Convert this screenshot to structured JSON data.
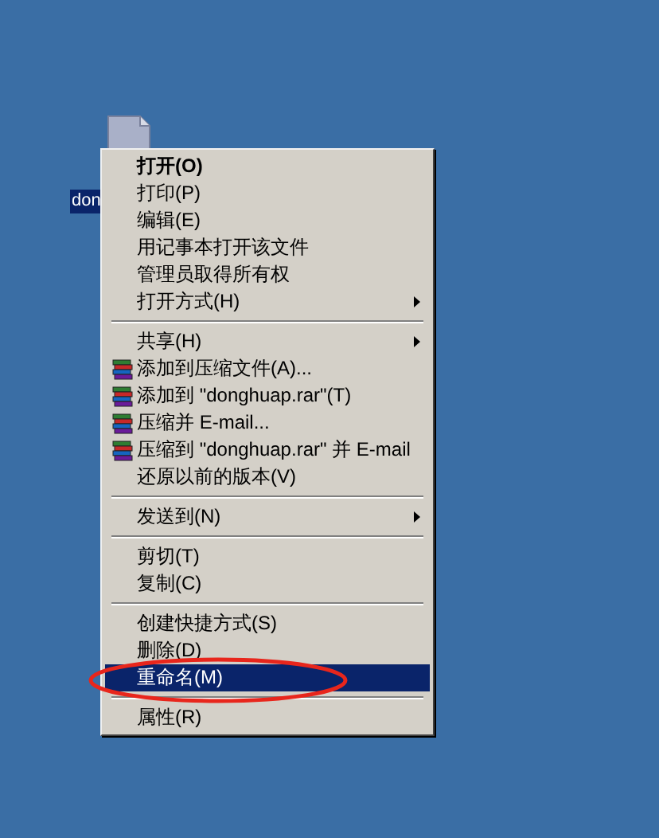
{
  "desktop_icon": {
    "label": "don",
    "selected": true
  },
  "context_menu": {
    "groups": [
      {
        "items": [
          {
            "label": "打开(O)",
            "kind": "plain",
            "default": true,
            "submenu": false,
            "selected": false
          },
          {
            "label": "打印(P)",
            "kind": "plain",
            "default": false,
            "submenu": false,
            "selected": false
          },
          {
            "label": "编辑(E)",
            "kind": "plain",
            "default": false,
            "submenu": false,
            "selected": false
          },
          {
            "label": "用记事本打开该文件",
            "kind": "plain",
            "default": false,
            "submenu": false,
            "selected": false
          },
          {
            "label": "管理员取得所有权",
            "kind": "plain",
            "default": false,
            "submenu": false,
            "selected": false
          },
          {
            "label": "打开方式(H)",
            "kind": "plain",
            "default": false,
            "submenu": true,
            "selected": false
          }
        ]
      },
      {
        "items": [
          {
            "label": "共享(H)",
            "kind": "plain",
            "default": false,
            "submenu": true,
            "selected": false
          },
          {
            "label": "添加到压缩文件(A)...",
            "kind": "archive",
            "default": false,
            "submenu": false,
            "selected": false
          },
          {
            "label": "添加到 \"donghuap.rar\"(T)",
            "kind": "archive",
            "default": false,
            "submenu": false,
            "selected": false
          },
          {
            "label": "压缩并 E-mail...",
            "kind": "archive",
            "default": false,
            "submenu": false,
            "selected": false
          },
          {
            "label": "压缩到 \"donghuap.rar\" 并 E-mail",
            "kind": "archive",
            "default": false,
            "submenu": false,
            "selected": false
          },
          {
            "label": "还原以前的版本(V)",
            "kind": "plain",
            "default": false,
            "submenu": false,
            "selected": false
          }
        ]
      },
      {
        "items": [
          {
            "label": "发送到(N)",
            "kind": "plain",
            "default": false,
            "submenu": true,
            "selected": false
          }
        ]
      },
      {
        "items": [
          {
            "label": "剪切(T)",
            "kind": "plain",
            "default": false,
            "submenu": false,
            "selected": false
          },
          {
            "label": "复制(C)",
            "kind": "plain",
            "default": false,
            "submenu": false,
            "selected": false
          }
        ]
      },
      {
        "items": [
          {
            "label": "创建快捷方式(S)",
            "kind": "plain",
            "default": false,
            "submenu": false,
            "selected": false
          },
          {
            "label": "删除(D)",
            "kind": "plain",
            "default": false,
            "submenu": false,
            "selected": false
          },
          {
            "label": "重命名(M)",
            "kind": "plain",
            "default": false,
            "submenu": false,
            "selected": true
          }
        ]
      },
      {
        "items": [
          {
            "label": "属性(R)",
            "kind": "plain",
            "default": false,
            "submenu": false,
            "selected": false
          }
        ]
      }
    ]
  },
  "annotation": {
    "kind": "ellipse",
    "color": "#e8261c"
  }
}
